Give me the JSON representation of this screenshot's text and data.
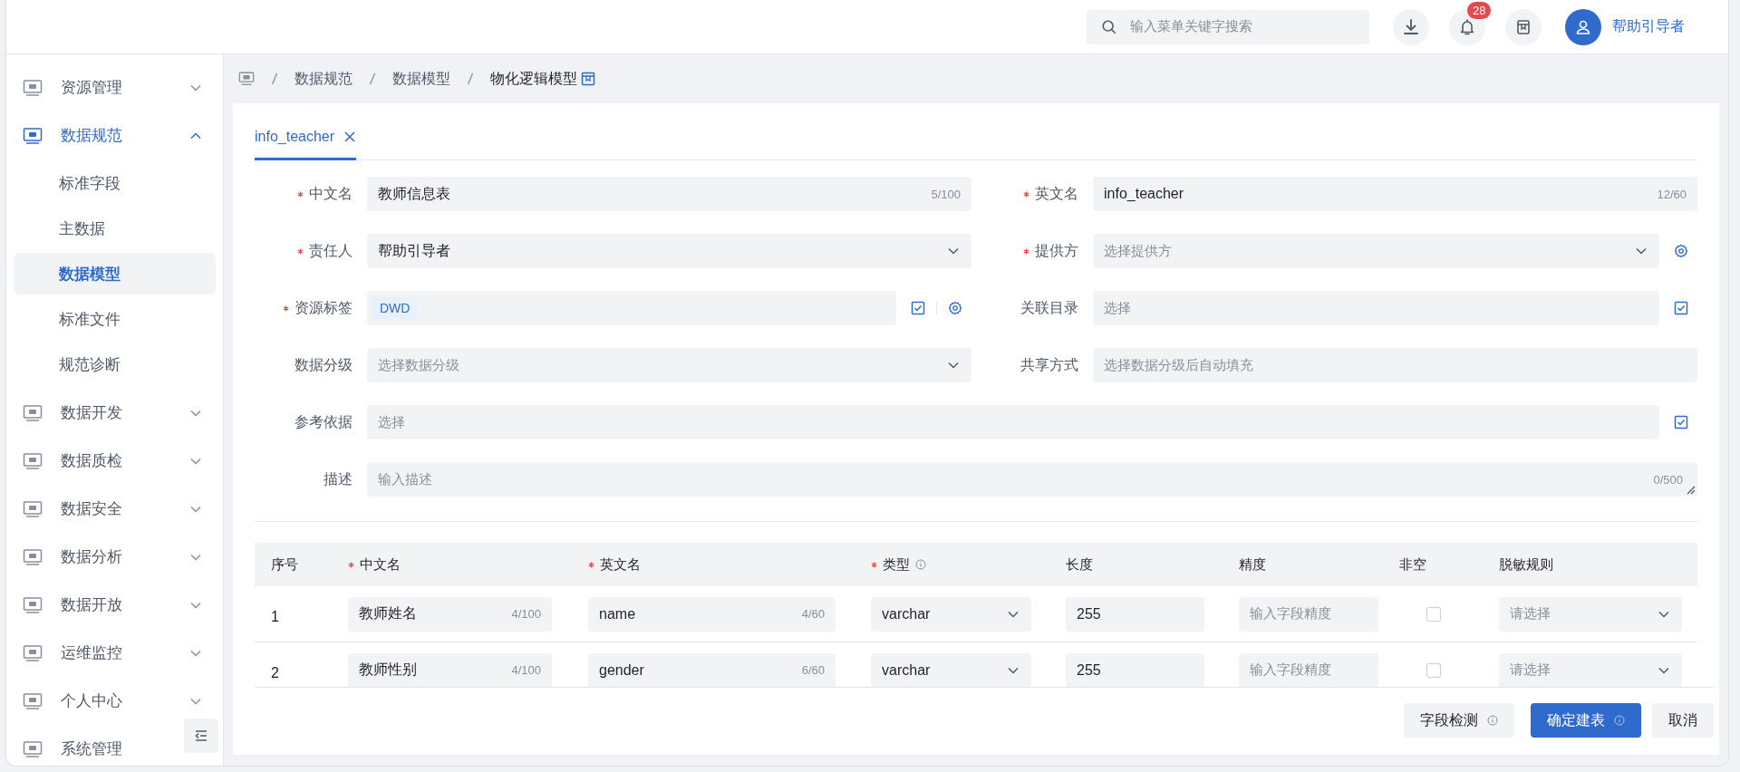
{
  "header": {
    "search": {
      "placeholder": "输入菜单关键字搜索"
    },
    "notification_count": "28",
    "user": "帮助引导者"
  },
  "sidebar": {
    "items": [
      {
        "label": "资源管理",
        "selected": false,
        "expanded": false
      },
      {
        "label": "数据规范",
        "selected": true,
        "expanded": true,
        "children": [
          {
            "label": "标准字段",
            "selected": false
          },
          {
            "label": "主数据",
            "selected": false
          },
          {
            "label": "数据模型",
            "selected": true
          },
          {
            "label": "标准文件",
            "selected": false
          },
          {
            "label": "规范诊断",
            "selected": false
          }
        ]
      },
      {
        "label": "数据开发",
        "selected": false,
        "expanded": false
      },
      {
        "label": "数据质检",
        "selected": false,
        "expanded": false
      },
      {
        "label": "数据安全",
        "selected": false,
        "expanded": false
      },
      {
        "label": "数据分析",
        "selected": false,
        "expanded": false
      },
      {
        "label": "数据开放",
        "selected": false,
        "expanded": false
      },
      {
        "label": "运维监控",
        "selected": false,
        "expanded": false
      },
      {
        "label": "个人中心",
        "selected": false,
        "expanded": false
      },
      {
        "label": "系统管理",
        "selected": false
      }
    ]
  },
  "breadcrumb": [
    "数据规范",
    "数据模型",
    "物化逻辑模型"
  ],
  "tabs": [
    {
      "label": "info_teacher",
      "selected": true
    }
  ],
  "form": {
    "rows": [
      [
        {
          "label": "中文名",
          "required": true,
          "kind": "input",
          "value": "教师信息表",
          "counter": "5/100"
        },
        {
          "label": "英文名",
          "required": true,
          "kind": "input",
          "value": "info_teacher",
          "counter": "12/60"
        }
      ],
      [
        {
          "label": "责任人",
          "required": true,
          "kind": "select",
          "value": "帮助引导者"
        },
        {
          "label": "提供方",
          "required": true,
          "kind": "select",
          "placeholder": "选择提供方",
          "actions": [
            {
              "kind": "settings"
            }
          ]
        }
      ],
      [
        {
          "label": "资源标签",
          "required": true,
          "kind": "tags",
          "tags": [
            "DWD"
          ],
          "actions": [
            {
              "kind": "pick"
            },
            {
              "kind": "settings"
            }
          ]
        },
        {
          "label": "关联目录",
          "required": false,
          "kind": "input",
          "placeholder": "选择",
          "actions": [
            {
              "kind": "pick"
            }
          ]
        }
      ],
      [
        {
          "label": "数据分级",
          "required": false,
          "kind": "select",
          "placeholder": "选择数据分级"
        },
        {
          "label": "共享方式",
          "required": false,
          "kind": "input",
          "placeholder": "选择数据分级后自动填充"
        }
      ],
      [
        {
          "label": "参考依据",
          "required": false,
          "kind": "input",
          "placeholder": "选择",
          "actions": [
            {
              "kind": "pick"
            }
          ]
        }
      ],
      [
        {
          "label": "描述",
          "required": false,
          "kind": "textarea",
          "placeholder": "输入描述",
          "counter": "0/500"
        }
      ]
    ]
  },
  "table": {
    "columns": [
      {
        "label": "序号",
        "required": false,
        "info": false
      },
      {
        "label": "中文名",
        "required": true,
        "info": false
      },
      {
        "label": "英文名",
        "required": true,
        "info": false
      },
      {
        "label": "类型",
        "required": true,
        "info": true
      },
      {
        "label": "长度",
        "required": false,
        "info": false
      },
      {
        "label": "精度",
        "required": false,
        "info": false
      },
      {
        "label": "非空",
        "required": false,
        "info": false
      },
      {
        "label": "脱敏规则",
        "required": false,
        "info": false
      }
    ],
    "rows": [
      {
        "index": "1",
        "cn_name": "教师姓名",
        "cn_counter": "4/100",
        "en_name": "name",
        "en_counter": "4/60",
        "type": "varchar",
        "length": "255",
        "precision_placeholder": "输入字段精度",
        "not_null": false,
        "mask_placeholder": "请选择"
      },
      {
        "index": "2",
        "cn_name": "教师性别",
        "cn_counter": "4/100",
        "en_name": "gender",
        "en_counter": "6/60",
        "type": "varchar",
        "length": "255",
        "precision_placeholder": "输入字段精度",
        "not_null": false,
        "mask_placeholder": "请选择"
      }
    ]
  },
  "footer_buttons": [
    {
      "label": "字段检测",
      "kind": "default",
      "info": true
    },
    {
      "label": "确定建表",
      "kind": "primary",
      "info": true
    },
    {
      "label": "取消",
      "kind": "default",
      "info": false
    }
  ]
}
